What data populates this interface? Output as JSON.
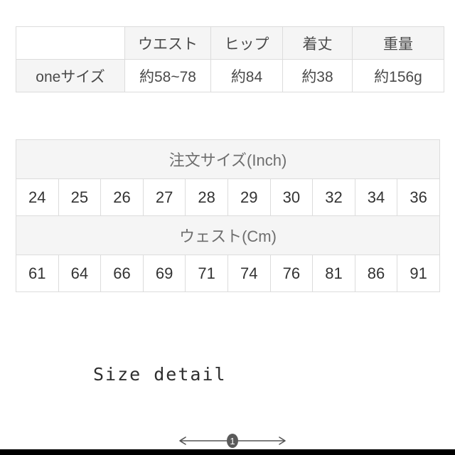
{
  "spec_table": {
    "name": "product-spec-table",
    "headers": [
      "",
      "ウエスト",
      "ヒップ",
      "着丈",
      "重量"
    ],
    "row_label": "oneサイズ",
    "values": [
      "約58~78",
      "約84",
      "約38",
      "約156g"
    ]
  },
  "order_table": {
    "name": "order-size-conversion-table",
    "inch_header": "注文サイズ(Inch)",
    "inch_values": [
      "24",
      "25",
      "26",
      "27",
      "28",
      "29",
      "30",
      "32",
      "34",
      "36"
    ],
    "cm_header": "ウェスト(Cm)",
    "cm_values": [
      "61",
      "64",
      "66",
      "69",
      "71",
      "74",
      "76",
      "81",
      "86",
      "91"
    ]
  },
  "caption": {
    "size_detail": "Size detail"
  },
  "measure_arrow": {
    "badge_label": "1",
    "badge_color": "#5a5a5a",
    "line_color": "#555555"
  },
  "colors": {
    "page_background": "#ffffff",
    "border": "#dcdcdc",
    "header_fill": "#f5f5f5",
    "text": "#3c3c3c",
    "bottom_band": "#000000"
  }
}
